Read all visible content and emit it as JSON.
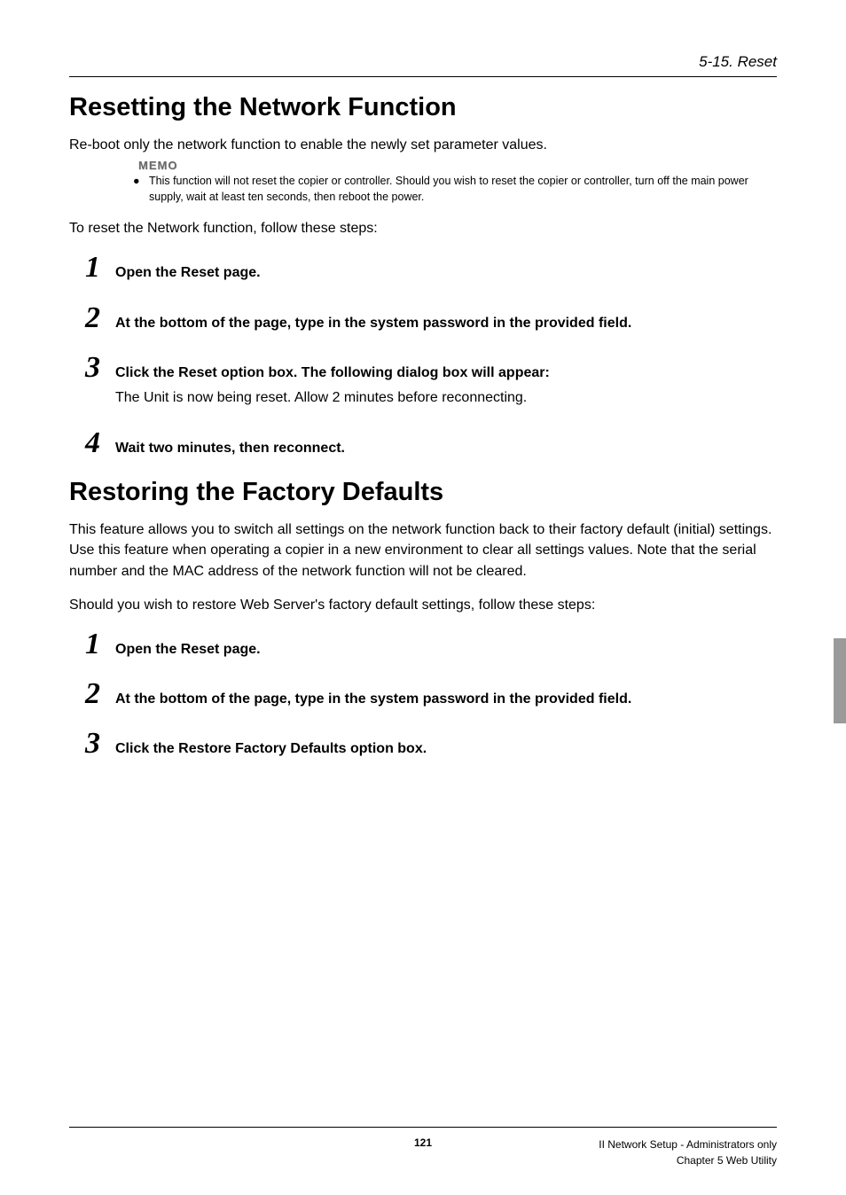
{
  "header": {
    "section_label": "5-15. Reset"
  },
  "section1": {
    "title": "Resetting the Network Function",
    "intro": "Re-boot only the network function to enable the newly set parameter values.",
    "memo_label": "MEMO",
    "memo_text": "This function will not reset the copier or controller. Should you wish to reset the copier or controller, turn off the main power supply, wait at least ten seconds, then reboot the power.",
    "lead": "To reset the Network function, follow these steps:",
    "steps": [
      {
        "num": "1",
        "title": "Open the Reset page."
      },
      {
        "num": "2",
        "title": "At the bottom of the page, type in the system password in the provided field."
      },
      {
        "num": "3",
        "title": "Click the Reset option box. The following dialog box will appear:",
        "body": "The Unit is now being reset. Allow 2 minutes before reconnecting."
      },
      {
        "num": "4",
        "title": "Wait two minutes, then reconnect."
      }
    ]
  },
  "section2": {
    "title": "Restoring the Factory Defaults",
    "intro": "This feature allows you to switch all settings on the network function back to their factory default (initial) settings. Use this feature when operating a copier in a new environment to clear all settings values. Note that the serial number and the MAC address of the network function will not be cleared.",
    "lead": "Should you wish to restore Web Server's factory default settings, follow these steps:",
    "steps": [
      {
        "num": "1",
        "title": "Open the Reset page."
      },
      {
        "num": "2",
        "title": "At the bottom of the page, type in the system password in the provided field."
      },
      {
        "num": "3",
        "title": "Click the Restore Factory Defaults option box."
      }
    ]
  },
  "footer": {
    "page": "121",
    "right1": "II Network Setup - Administrators only",
    "right2": "Chapter 5 Web Utility"
  }
}
